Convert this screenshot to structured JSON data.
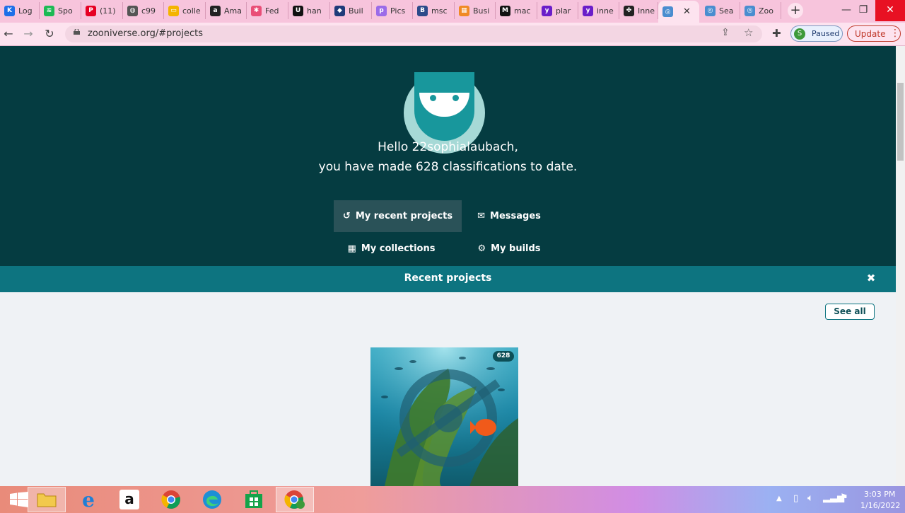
{
  "browser": {
    "tabs": [
      {
        "label": "Log",
        "color": "#1e6fe8",
        "glyph": "K"
      },
      {
        "label": "Spo",
        "color": "#1db954",
        "glyph": "≋"
      },
      {
        "label": "(11)",
        "color": "#e60023",
        "glyph": "P"
      },
      {
        "label": "c99",
        "color": "#555555",
        "glyph": "◍"
      },
      {
        "label": "colle",
        "color": "#f4b400",
        "glyph": "▭"
      },
      {
        "label": "Ama",
        "color": "#222222",
        "glyph": "a"
      },
      {
        "label": "Fed",
        "color": "#e94e77",
        "glyph": "✱"
      },
      {
        "label": "han",
        "color": "#111111",
        "glyph": "U"
      },
      {
        "label": "Buil",
        "color": "#1f3b7a",
        "glyph": "◆"
      },
      {
        "label": "Pics",
        "color": "#9b6be8",
        "glyph": "p"
      },
      {
        "label": "msc",
        "color": "#2c4a8a",
        "glyph": "B"
      },
      {
        "label": "Busi",
        "color": "#f08a24",
        "glyph": "▦"
      },
      {
        "label": "mac",
        "color": "#111111",
        "glyph": "M"
      },
      {
        "label": "plar",
        "color": "#6a1ec9",
        "glyph": "y"
      },
      {
        "label": "inne",
        "color": "#6a1ec9",
        "glyph": "y"
      },
      {
        "label": "Inne",
        "color": "#222222",
        "glyph": "✤"
      },
      {
        "label": "",
        "color": "#4a8dcf",
        "glyph": "◎"
      },
      {
        "label": "Sea",
        "color": "#4a8dcf",
        "glyph": "◎"
      },
      {
        "label": "Zoo",
        "color": "#4a8dcf",
        "glyph": "◎"
      }
    ],
    "url": "zooniverse.org/#projects",
    "profile_initial": "S",
    "profile_label": "Paused",
    "update_label": "Update",
    "new_tab": "+",
    "win_min": "—",
    "win_max": "❐",
    "win_close": "✕"
  },
  "page": {
    "greeting_line1": "Hello 22sophialaubach,",
    "greeting_line2": "you have made 628 classifications to date.",
    "nav": {
      "recent": "My recent projects",
      "messages": "Messages",
      "collections": "My collections",
      "builds": "My builds"
    },
    "recent_title": "Recent projects",
    "close_symbol": "✖",
    "see_all": "See all",
    "project_count": "628"
  },
  "taskbar": {
    "time": "3:03 PM",
    "date": "1/16/2022"
  },
  "colors": {
    "hero": "#053c41",
    "bar": "#0d7480",
    "tabstrip": "#f7c4dc"
  }
}
